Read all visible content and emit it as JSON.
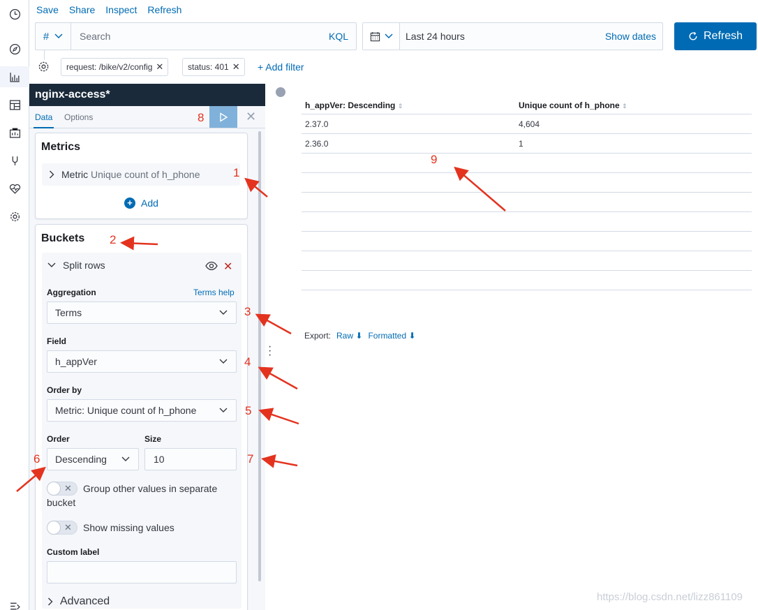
{
  "top_menu": [
    "Save",
    "Share",
    "Inspect",
    "Refresh"
  ],
  "query": {
    "type_symbol": "#",
    "placeholder": "Search",
    "language": "KQL"
  },
  "date": {
    "range": "Last 24 hours",
    "show_dates": "Show dates"
  },
  "refresh_button": "Refresh",
  "filters": [
    {
      "label": "request: /bike/v2/config"
    },
    {
      "label": "status: 401"
    }
  ],
  "add_filter": "+ Add filter",
  "editor": {
    "title": "nginx-access*",
    "tabs": {
      "data": "Data",
      "options": "Options"
    },
    "metrics": {
      "title": "Metrics",
      "item_label": "Metric",
      "item_value": "Unique count of h_phone",
      "add": "Add"
    },
    "buckets": {
      "title": "Buckets",
      "split_rows": "Split rows",
      "aggregation_label": "Aggregation",
      "aggregation_help": "Terms help",
      "aggregation_value": "Terms",
      "field_label": "Field",
      "field_value": "h_appVer",
      "order_by_label": "Order by",
      "order_by_value": "Metric: Unique count of h_phone",
      "order_label": "Order",
      "order_value": "Descending",
      "size_label": "Size",
      "size_value": "10",
      "group_other_line1": "Group other values in separate",
      "group_other_line2": "bucket",
      "show_missing": "Show missing values",
      "custom_label": "Custom label",
      "custom_label_value": "",
      "advanced": "Advanced"
    }
  },
  "table": {
    "headers": [
      "h_appVer: Descending",
      "Unique count of h_phone"
    ],
    "rows": [
      [
        "2.37.0",
        "4,604"
      ],
      [
        "2.36.0",
        "1"
      ]
    ]
  },
  "export": {
    "label": "Export:",
    "raw": "Raw",
    "formatted": "Formatted"
  },
  "annotations": [
    "1",
    "2",
    "3",
    "4",
    "5",
    "6",
    "7",
    "8",
    "9"
  ],
  "annotation_color": "#e3331f",
  "accent_color": "#006bb4",
  "watermark": "https://blog.csdn.net/lizz861109"
}
